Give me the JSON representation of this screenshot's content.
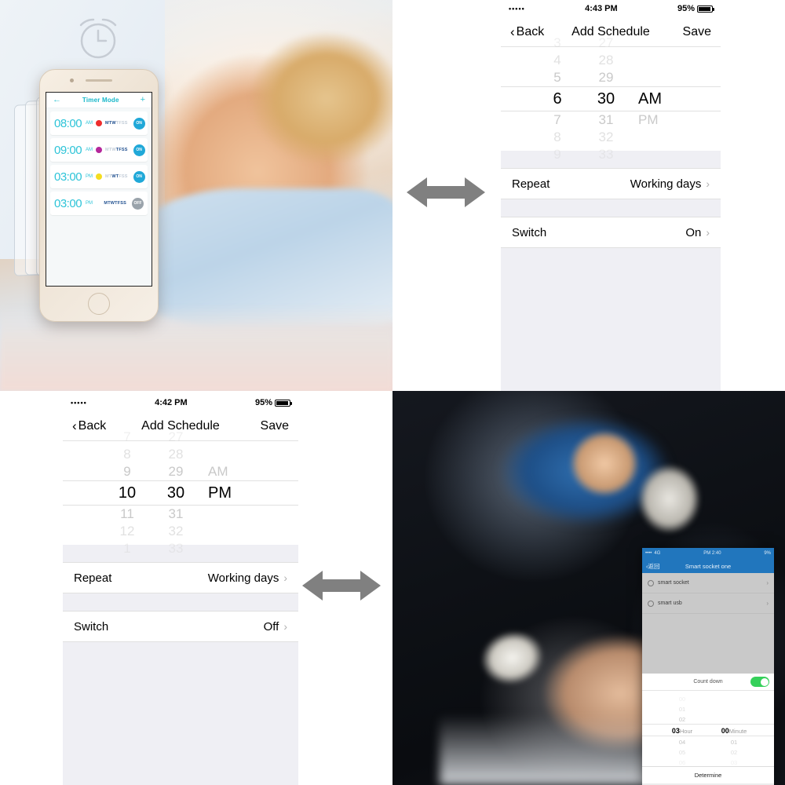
{
  "top_left": {
    "clock_icon": "alarm-clock-icon",
    "app": {
      "nav": {
        "back_icon": "back-arrow-icon",
        "title": "Timer Mode",
        "add_icon": "plus-icon"
      },
      "timers": [
        {
          "time": "08:00",
          "meridiem": "AM",
          "dot_color": "#ee2d2d",
          "days_active": "MTW",
          "days_inactive": "TFSS",
          "switch": "ON"
        },
        {
          "time": "09:00",
          "meridiem": "AM",
          "dot_color": "#b5279b",
          "days_active": "TFSS",
          "days_inactive": "MTW",
          "switch": "ON"
        },
        {
          "time": "03:00",
          "meridiem": "PM",
          "dot_color": "#f4dd20",
          "days_active": "WT",
          "days_inactive": "MT FSS",
          "switch": "ON"
        },
        {
          "time": "03:00",
          "meridiem": "PM",
          "dot_color": "",
          "days_active": "MTWTFSS",
          "days_inactive": "",
          "switch": "OFF"
        }
      ]
    }
  },
  "top_right": {
    "status": {
      "dots": "•••••",
      "time": "4:43 PM",
      "battery": "95%"
    },
    "nav": {
      "back": "Back",
      "title": "Add Schedule",
      "save": "Save"
    },
    "picker": {
      "hours": [
        "3",
        "4",
        "5",
        "6",
        "7",
        "8",
        "9"
      ],
      "minutes": [
        "27",
        "28",
        "29",
        "30",
        "31",
        "32",
        "33"
      ],
      "meridiem": [
        "AM",
        "PM"
      ],
      "selected_hour": "6",
      "selected_minute": "30",
      "selected_meridiem": "AM"
    },
    "rows": [
      {
        "label": "Repeat",
        "value": "Working days"
      },
      {
        "label": "Switch",
        "value": "On"
      }
    ]
  },
  "bottom_left": {
    "status": {
      "dots": "•••••",
      "time": "4:42 PM",
      "battery": "95%"
    },
    "nav": {
      "back": "Back",
      "title": "Add Schedule",
      "save": "Save"
    },
    "picker": {
      "hours": [
        "7",
        "8",
        "9",
        "10",
        "11",
        "12",
        "1"
      ],
      "minutes": [
        "27",
        "28",
        "29",
        "30",
        "31",
        "32",
        "33"
      ],
      "meridiem": [
        "AM",
        "PM"
      ],
      "selected_hour": "10",
      "selected_minute": "30",
      "selected_meridiem": "PM"
    },
    "rows": [
      {
        "label": "Repeat",
        "value": "Working days"
      },
      {
        "label": "Switch",
        "value": "Off"
      }
    ]
  },
  "bottom_right": {
    "phone": {
      "status": {
        "signal": "••••",
        "network": "4G",
        "time": "PM 2:40",
        "battery": "9%"
      },
      "nav": {
        "back": "返回",
        "title": "Smart socket one"
      },
      "items": [
        {
          "label": "smart socket"
        },
        {
          "label": "smart usb"
        }
      ],
      "countdown": {
        "title": "Count down",
        "toggle": "on",
        "hours": [
          "00",
          "01",
          "02",
          "03",
          "04",
          "05",
          "06"
        ],
        "minutes": [
          "00",
          "01",
          "02",
          "03"
        ],
        "selected_hour": "03",
        "hour_unit": "Hour",
        "selected_minute": "00",
        "minute_unit": "Minute",
        "confirm": "Determine"
      }
    }
  },
  "arrows": {
    "icon": "double-arrow-horizontal-icon",
    "color": "#808080"
  }
}
